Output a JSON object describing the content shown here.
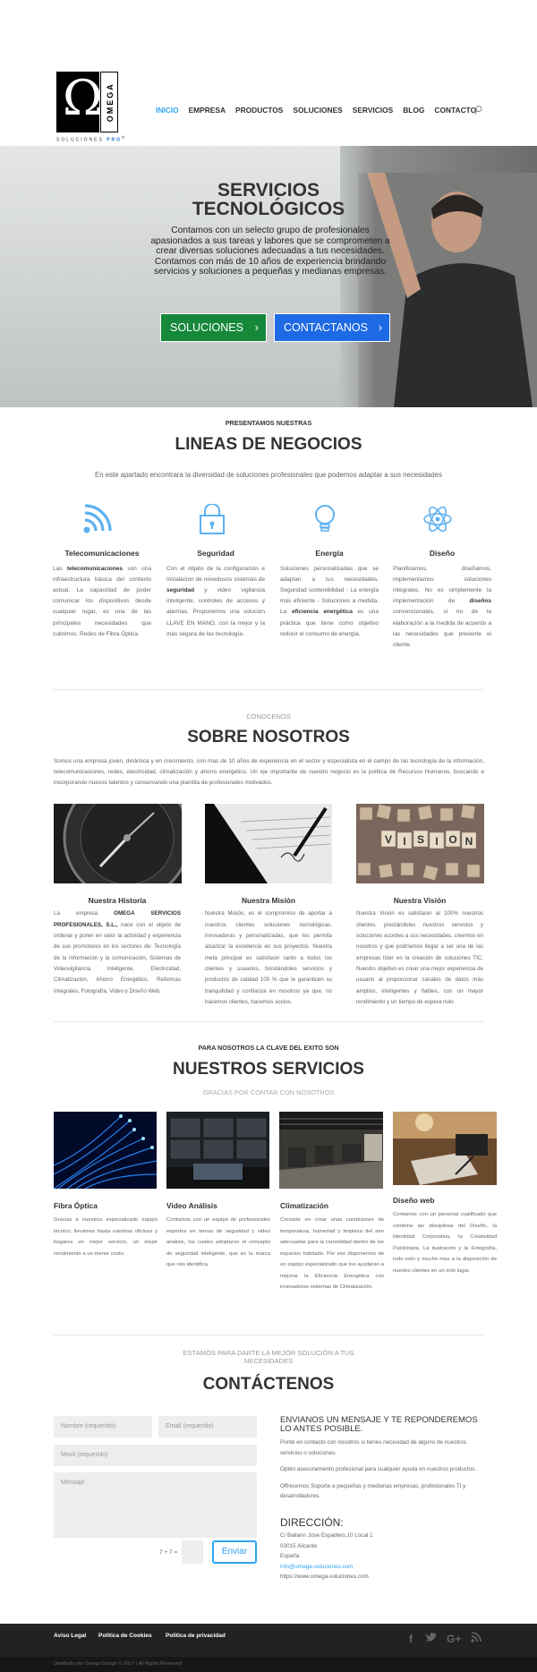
{
  "logo": {
    "word": "OMEGA",
    "sub": "SOLUCIONES",
    "sub_brand": "PRO",
    "tm": "®"
  },
  "nav": {
    "items": [
      "INICIO",
      "EMPRESA",
      "PRODUCTOS",
      "SOLUCIONES",
      "SERVICIOS",
      "BLOG",
      "CONTACTO"
    ],
    "active": "INICIO"
  },
  "hero": {
    "title_line1": "SERVICIOS",
    "title_line2": "TECNOLÓGICOS",
    "text": "Contamos con un selecto grupo de profesionales apasionados a sus tareas y labores que se comprometen a crear diversas soluciones adecuadas a tus necesidades. Contamos con más de 10 años de experiencia brindando servicios y soluciones a pequeñas y medianas empresas.",
    "btn1": "SOLUCIONES",
    "btn2": "CONTACTANOS",
    "btn1_color": "#16883a",
    "btn2_color": "#1e6ae4"
  },
  "lineas": {
    "kicker": "PRESENTAMOS NUESTRAS",
    "title": "LINEAS DE NEGOCIOS",
    "intro": "En este apartado encontrara la diversidad de soluciones profesionales que podemos adaptar a sus necesidades",
    "items": [
      {
        "icon": "wifi-icon",
        "title": "Telecomunicaciones",
        "pre": "Las ",
        "bold": "telecomunicaciones",
        "post": " son una infraestructura básica del contexto actual. La capacidad de poder comunicar los dispositivos desde cualquier lugar, es una de las principales necesidades que cubrimos. Redes de Fibra Óptica."
      },
      {
        "icon": "lock-icon",
        "title": "Seguridad",
        "pre": "Con el objeto de la configuración e instalación de novedosos sistemas de ",
        "bold": "seguridad",
        "post": " y video vigilancia inteligente, controles de accesos y alarmas. Proponemos una solución LLAVE EN MANO, con la mejor y la más segura de las tecnología."
      },
      {
        "icon": "lightbulb-icon",
        "title": "Energía",
        "pre": "Soluciones personalizadas que se adaptan a tus necesidades. Seguridad sostenibilidad - La energía más eficiente - Soluciones a medida. La ",
        "bold": "eficiencia energética",
        "post": " es una práctica que tiene como objetivo reducir el consumo de energía."
      },
      {
        "icon": "atom-icon",
        "title": "Diseño",
        "pre": "Planificamos, diseñamos, implementamos soluciones integrales. No es simplemente la implementación de ",
        "bold": "diseños",
        "post": " convencionales, si no de la elaboración a la medida de acuerdo a las necesidades que presente el cliente."
      }
    ]
  },
  "about": {
    "kicker": "CONOCENOS",
    "title": "SOBRE NOSOTROS",
    "intro": "Somos una empresa joven, dinámica y en crecimiento, con mas de 10 años de experiencia en el sector y especialista en el campo de las tecnología de la información, telecomunicaciones, redes, electricidad, climatización y ahorro energético. Un eje importante de nuestro negocio es la política de Recursos Humanos, buscando e incorporando nuevos talentos y conservando una plantilla de profesionales motivados.",
    "cols": [
      {
        "title": "Nuestra Historia",
        "pre": "La empresa ",
        "bold": "OMEGA SERVICIOS PROFESIONALES, S.L.,",
        "post": " nace con el objeto de ordenar y poner en valor la actividad y experiencia de sus promotores en los sectores de: Tecnología de la Información y la comunicación, Sistemas de Videovigilancia Inteligente, Electricidad, Climatización, Ahorro Energético, Reformas Integrales, Fotografía, Video y Diseño Web."
      },
      {
        "title": "Nuestra Misión",
        "pre": "Nuestra Misión, es el compromiso de aportar a nuestros clientes soluciones tecnológicas, innovadoras y personalizadas, que les permita alcanzar la excelencia en sus proyectos. Nuestra meta principal es satisfacer tanto a todos los clientes y usuarios, brindándoles servicios y productos de calidad 100 % que le garanticen su tranquilidad y confianza en nosotros ya que, no hacemos clientes, hacemos socios.",
        "bold": "",
        "post": ""
      },
      {
        "title": "Nuestra Visión",
        "pre": "Nuestra Visión es satisfacer al 100% nuestros clientes, prestándoles nuestros servicios y soluciones acordes a sus necesidades, creemos en nosotros y que podríamos llegar a ser una de las empresas líder en la creación de soluciones TIC. Nuestro objetivo es crear una mejor experiencia de usuario al proporcionar canales de datos más amplios, inteligentes y fiables, con un mayor rendimiento y un tiempo de espera nulo.",
        "bold": "",
        "post": ""
      }
    ],
    "vision_tiles": "VISION"
  },
  "services": {
    "kicker": "PARA NOSOTROS LA CLAVE DEL EXITO SON",
    "title": "NUESTROS SERVICIOS",
    "subtitle": "GRACIAS POR CONTAR CON NOSOTROS",
    "items": [
      {
        "title": "Fibra Óptica",
        "text": "Gracias a nuestros especializado equipo técnico, llevamos hasta vuestras oficinas y hogares un mejor servicio, un mejor rendimiento a un menor costo."
      },
      {
        "title": "Video Análisis",
        "text": "Contamos con un equipo de profesionales expertos en temas de seguridad y video análisis, los cuales adoptaron el concepto de seguridad inteligente, que es la marca que nos identifica."
      },
      {
        "title": "Climatización",
        "text": "Consiste en crear unas condiciones de temperatura, humedad y limpieza del aire adecuadas para la comodidad dentro de los espacios habitado. Por eso disponemos de un equipo especializado que los ayudaran a mejorar la Eficiencia Energética con innovadores sistemas de Climatización."
      },
      {
        "title": "Diseño web",
        "text": "Contamos con un personal cualificado que combina las disciplinas del Diseño, la Identidad Corporativa, la Creatividad Publicitaria, La ilustración y la Fotografía, todo esto y mucho mas a la disposición de nuestro clientes en un solo lugar."
      }
    ]
  },
  "contact": {
    "kicker": "ESTAMOS PARA DARTE LA MEJOR SOLUCIÓN A TUS NECESIDADES",
    "title": "CONTÁCTENOS",
    "name_ph": "Nombre (requerido)",
    "email_ph": "Email (requerido)",
    "phone_ph": "Movil (requerido)",
    "msg_ph": "Mensaje",
    "captcha": "7 + 7 =",
    "send": "Enviar",
    "info_title": "ENVIANOS UN MENSAJE Y TE REPONDEREMOS LO ANTES POSIBLE.",
    "p1": "Ponte en contacto con nosotros si tienes necesidad de alguno de nuestros servicios o soluciones.",
    "p2": "Optén asesoramiento profesional para cualquier ayuda en nuestros productos.",
    "p3": "Offrecemos Soporte a pequeñas y medianas empresas, profesionales TI y desarrolladores.",
    "dir_title": "DIRECCIÓN:",
    "addr1": "C/ Bailarin Jose Espadero,10 Local 1",
    "addr2": "03015 Alicante",
    "addr3": "España",
    "email": "info@omega-soluciones.com",
    "web": "https://www.omega-soluciones.com"
  },
  "footer": {
    "links": [
      "Aviso Legal",
      "Politica de Cookies",
      "Politica de privacidad"
    ],
    "copy": "Diseñado por Omega Design © 2017 | All Rights Reserved",
    "social": [
      "f",
      "twitter-icon",
      "G+",
      "rss-icon"
    ],
    "gplus": "G+",
    "fb": "f"
  }
}
